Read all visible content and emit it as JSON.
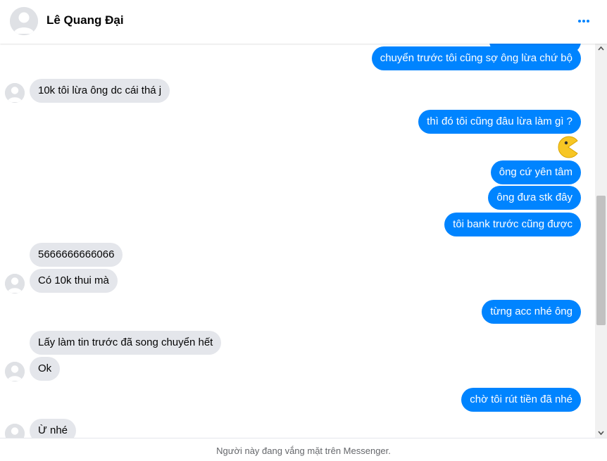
{
  "header": {
    "contact_name": "Lê Quang Đại",
    "more_icon": "more-horizontal-icon",
    "accent_color": "#0084ff"
  },
  "messages": [
    {
      "direction": "out",
      "text": "chuyển trước tôi cũng sợ ông lừa chứ bộ"
    },
    {
      "direction": "in",
      "text": "10k tôi lừa ông dc cái thá j"
    },
    {
      "direction": "out",
      "text": "thì đó tôi cũng đâu lừa làm gì ?"
    },
    {
      "direction": "out",
      "emoji": "pacman-emoji-icon"
    },
    {
      "direction": "out",
      "text": "ông cứ yên tâm"
    },
    {
      "direction": "out",
      "text": "ông đưa stk đây"
    },
    {
      "direction": "out",
      "text": "tôi bank trước cũng được"
    },
    {
      "direction": "in",
      "text": "5666666666066"
    },
    {
      "direction": "in",
      "text": "Có 10k thui mà"
    },
    {
      "direction": "out",
      "text": "từng acc nhé ông"
    },
    {
      "direction": "in",
      "text": "Lấy làm tin trước đã song chuyển hết"
    },
    {
      "direction": "in",
      "text": "Ok"
    },
    {
      "direction": "out",
      "text": "chờ tôi rút tiền đã nhé"
    },
    {
      "direction": "in",
      "text": "Ừ nhé"
    }
  ],
  "footer": {
    "status_text": "Người này đang vắng mặt trên Messenger."
  },
  "colors": {
    "outgoing_bubble": "#0084ff",
    "incoming_bubble": "#e4e6eb"
  }
}
